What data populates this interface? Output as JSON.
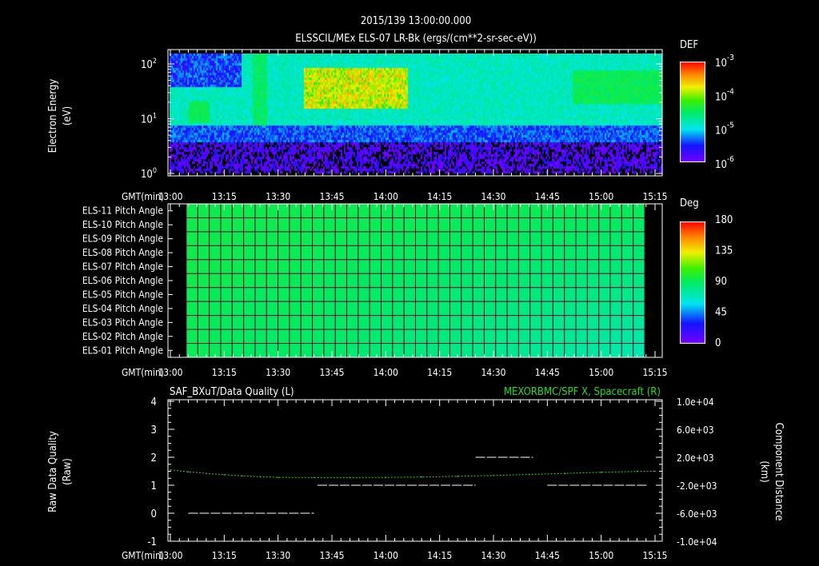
{
  "header": {
    "datetime": "2015/139 13:00:00.000"
  },
  "chart_data": [
    {
      "type": "heatmap",
      "title": "ELSSCIL/MEx ELS-07 LR-Bk  (ergs/(cm**2-sr-sec-eV))",
      "xlabel": "GMT(min)",
      "ylabel": "Electron Energy",
      "yunit": "(eV)",
      "x_ticks": [
        "13:00",
        "13:15",
        "13:30",
        "13:45",
        "14:00",
        "14:15",
        "14:30",
        "14:45",
        "15:00",
        "15:15"
      ],
      "y_ticks": [
        {
          "base": "10",
          "exp": "0"
        },
        {
          "base": "10",
          "exp": "1"
        },
        {
          "base": "10",
          "exp": "2"
        }
      ],
      "yscale": "log",
      "ylim": [
        1,
        150
      ],
      "colorbar": {
        "label": "DEF",
        "scale": "log",
        "range": [
          1e-06,
          0.001
        ],
        "ticks": [
          {
            "base": "10",
            "exp": "-3"
          },
          {
            "base": "10",
            "exp": "-4"
          },
          {
            "base": "10",
            "exp": "-5"
          },
          {
            "base": "10",
            "exp": "-6"
          }
        ]
      },
      "features": [
        {
          "desc": "enhanced flux 15-80 eV",
          "start": "13:38",
          "end": "14:05",
          "level": "~2e-4"
        },
        {
          "desc": "background 8-100 eV",
          "level": "~1e-5"
        },
        {
          "desc": "low flux below 4 eV",
          "level": "~1e-6"
        }
      ]
    },
    {
      "type": "heatmap",
      "xlabel": "GMT(min)",
      "rows": [
        "ELS-11 Pitch Angle",
        "ELS-10 Pitch Angle",
        "ELS-09 Pitch Angle",
        "ELS-08 Pitch Angle",
        "ELS-07 Pitch Angle",
        "ELS-06 Pitch Angle",
        "ELS-05 Pitch Angle",
        "ELS-04 Pitch Angle",
        "ELS-03 Pitch Angle",
        "ELS-02 Pitch Angle",
        "ELS-01 Pitch Angle"
      ],
      "x_ticks": [
        "13:00",
        "13:15",
        "13:30",
        "13:45",
        "14:00",
        "14:15",
        "14:30",
        "14:45",
        "15:00",
        "15:15"
      ],
      "time_range": [
        "13:05",
        "15:13"
      ],
      "values_deg_approx": {
        "ELS-11_start": 95,
        "ELS-11_end": 92,
        "ELS-01_start": 90,
        "ELS-01_end": 75
      },
      "colorbar": {
        "label": "Deg",
        "range": [
          0,
          180
        ],
        "ticks": [
          "180",
          "135",
          "90",
          "45",
          "0"
        ]
      }
    },
    {
      "type": "line",
      "title_left": "SAF_BXuT/Data Quality (L)",
      "title_right": "MEXORBMC/SPF X, Spacecraft (R)",
      "xlabel": "GMT(min)",
      "ylabel_left": "Raw Data Quality",
      "ylabel_left_unit": "(Raw)",
      "ylabel_right": "Component Distance",
      "ylabel_right_unit": "(km)",
      "x_ticks": [
        "13:00",
        "13:15",
        "13:30",
        "13:45",
        "14:00",
        "14:15",
        "14:30",
        "14:45",
        "15:00",
        "15:15"
      ],
      "y_left_ticks": [
        "4",
        "3",
        "2",
        "1",
        "0",
        "-1"
      ],
      "y_left_range": [
        -1,
        4
      ],
      "y_right_ticks": [
        "1.0e+04",
        "6.0e+03",
        "2.0e+03",
        "-2.0e+03",
        "-6.0e+03",
        "-1.0e+04"
      ],
      "y_right_range": [
        -10000,
        10000
      ],
      "series": [
        {
          "name": "Data Quality",
          "axis": "left",
          "color": "#ffffff",
          "segments": [
            {
              "start": "13:05",
              "end": "13:40",
              "value": 0
            },
            {
              "start": "13:41",
              "end": "14:25",
              "value": 1
            },
            {
              "start": "14:25",
              "end": "14:41",
              "value": 2
            },
            {
              "start": "14:45",
              "end": "15:13",
              "value": 1
            }
          ]
        },
        {
          "name": "SPF X",
          "axis": "right",
          "color": "#22dd22",
          "x_min": [
            0,
            5,
            10,
            15,
            20,
            25,
            30,
            40,
            50,
            60,
            70,
            80,
            90,
            100,
            110,
            120,
            130,
            135
          ],
          "values_km": [
            200,
            -80,
            -300,
            -500,
            -650,
            -780,
            -870,
            -900,
            -900,
            -880,
            -820,
            -720,
            -600,
            -450,
            -300,
            -150,
            -20,
            0
          ]
        }
      ]
    }
  ],
  "colors": {
    "white": "#ffffff",
    "green": "#22dd22",
    "grid": "#8b1a3a"
  }
}
